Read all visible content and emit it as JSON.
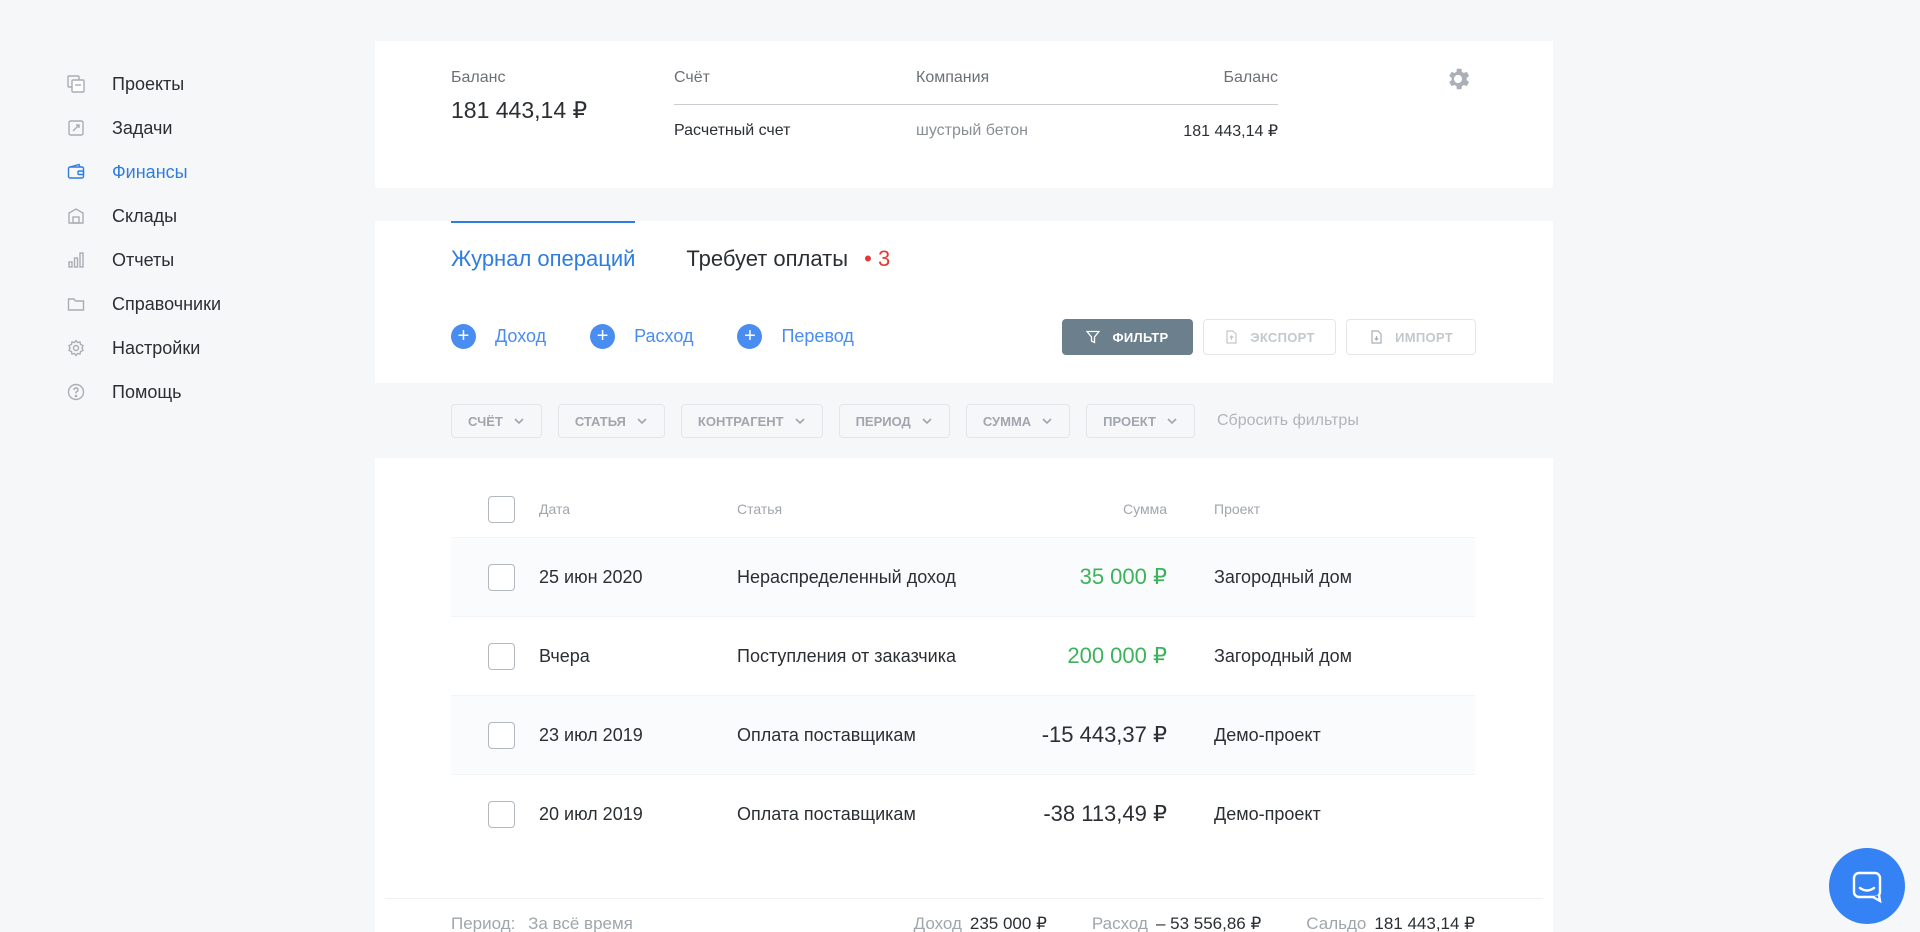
{
  "sidebar": {
    "items": [
      {
        "label": "Проекты",
        "icon": "projects-icon"
      },
      {
        "label": "Задачи",
        "icon": "tasks-icon"
      },
      {
        "label": "Финансы",
        "icon": "wallet-icon",
        "active": true
      },
      {
        "label": "Склады",
        "icon": "warehouse-icon"
      },
      {
        "label": "Отчеты",
        "icon": "chart-icon"
      },
      {
        "label": "Справочники",
        "icon": "folder-icon"
      },
      {
        "label": "Настройки",
        "icon": "gear-icon"
      },
      {
        "label": "Помощь",
        "icon": "help-icon"
      }
    ]
  },
  "balance": {
    "label": "Баланс",
    "value": "181 443,14 ₽",
    "accounts": {
      "headers": {
        "account": "Счёт",
        "company": "Компания",
        "balance": "Баланс"
      },
      "rows": [
        {
          "account": "Расчетный счет",
          "company": "шустрый бетон",
          "balance": "181 443,14 ₽"
        }
      ]
    }
  },
  "tabs": {
    "journal": "Журнал операций",
    "payment": "Требует оплаты",
    "payment_dot": "•",
    "payment_count": "3"
  },
  "actions": {
    "income": "Доход",
    "expense": "Расход",
    "transfer": "Перевод"
  },
  "toolbar": {
    "filter": "ФИЛЬТР",
    "export": "ЭКСПОРТ",
    "import": "ИМПОРТ"
  },
  "filters": {
    "chips": [
      "СЧЁТ",
      "СТАТЬЯ",
      "КОНТРАГЕНТ",
      "ПЕРИОД",
      "СУММА",
      "ПРОЕКТ"
    ],
    "reset": "Сбросить фильтры"
  },
  "table": {
    "headers": {
      "date": "Дата",
      "article": "Статья",
      "sum": "Сумма",
      "project": "Проект"
    },
    "rows": [
      {
        "date": "25 июн 2020",
        "article": "Нераспределенный доход",
        "sum": "35 000 ₽",
        "project": "Загородный дом",
        "positive": true
      },
      {
        "date": "Вчера",
        "article": "Поступления от заказчика",
        "sum": "200 000 ₽",
        "project": "Загородный дом",
        "positive": true
      },
      {
        "date": "23 июл 2019",
        "article": "Оплата поставщикам",
        "sum": "-15 443,37 ₽",
        "project": "Демо-проект",
        "positive": false
      },
      {
        "date": "20 июл 2019",
        "article": "Оплата поставщикам",
        "sum": "-38 113,49 ₽",
        "project": "Демо-проект",
        "positive": false
      }
    ]
  },
  "summary": {
    "period_label": "Период:",
    "period_value": "За всё время",
    "income_label": "Доход",
    "income_value": "235 000 ₽",
    "expense_label": "Расход",
    "expense_value": "– 53 556,86 ₽",
    "saldo_label": "Сальдо",
    "saldo_value": "181 443,14 ₽"
  },
  "colors": {
    "accent": "#2f7de1",
    "positive": "#3cb35a",
    "alert": "#e53935",
    "filter_button": "#6b7f8c",
    "chat": "#3582f5"
  }
}
